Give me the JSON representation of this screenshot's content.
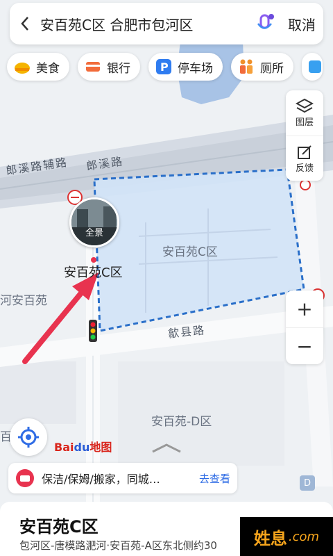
{
  "search": {
    "query": "安百苑C区 合肥市包河区",
    "cancel_label": "取消"
  },
  "categories": [
    {
      "label": "美食",
      "icon": "food-icon"
    },
    {
      "label": "银行",
      "icon": "bank-icon"
    },
    {
      "label": "停车场",
      "icon": "parking-icon"
    },
    {
      "label": "厕所",
      "icon": "toilet-icon"
    }
  ],
  "side_tools": {
    "layers_label": "图层",
    "feedback_label": "反馈"
  },
  "zoom": {
    "in_label": "+",
    "out_label": "−"
  },
  "map_labels": {
    "road_aux": "郎溪路辅路",
    "road_main": "郎溪路",
    "road_shexian": "歙县路",
    "area_c": "安百苑C区",
    "area_c_marker": "安百苑C区",
    "area_d": "安百苑-D区",
    "area_left": "河安百苑",
    "area_left_bottom": "百苑"
  },
  "panorama": {
    "label": "全景"
  },
  "brand": {
    "bai": "Bai",
    "du": "du",
    "map": "地图"
  },
  "promo": {
    "text": "保洁/保姆/搬家，同城…",
    "action": "去查看"
  },
  "badge_d": "D",
  "place": {
    "title": "安百苑C区",
    "address": "包河区-唐模路淝河·安百苑-A区东北侧约30"
  },
  "watermark": {
    "main": "姓息",
    "dom": ".com"
  },
  "colors": {
    "accent": "#2f6ce5",
    "boundary": "#2a6fc9",
    "arrow": "#e8334f"
  }
}
